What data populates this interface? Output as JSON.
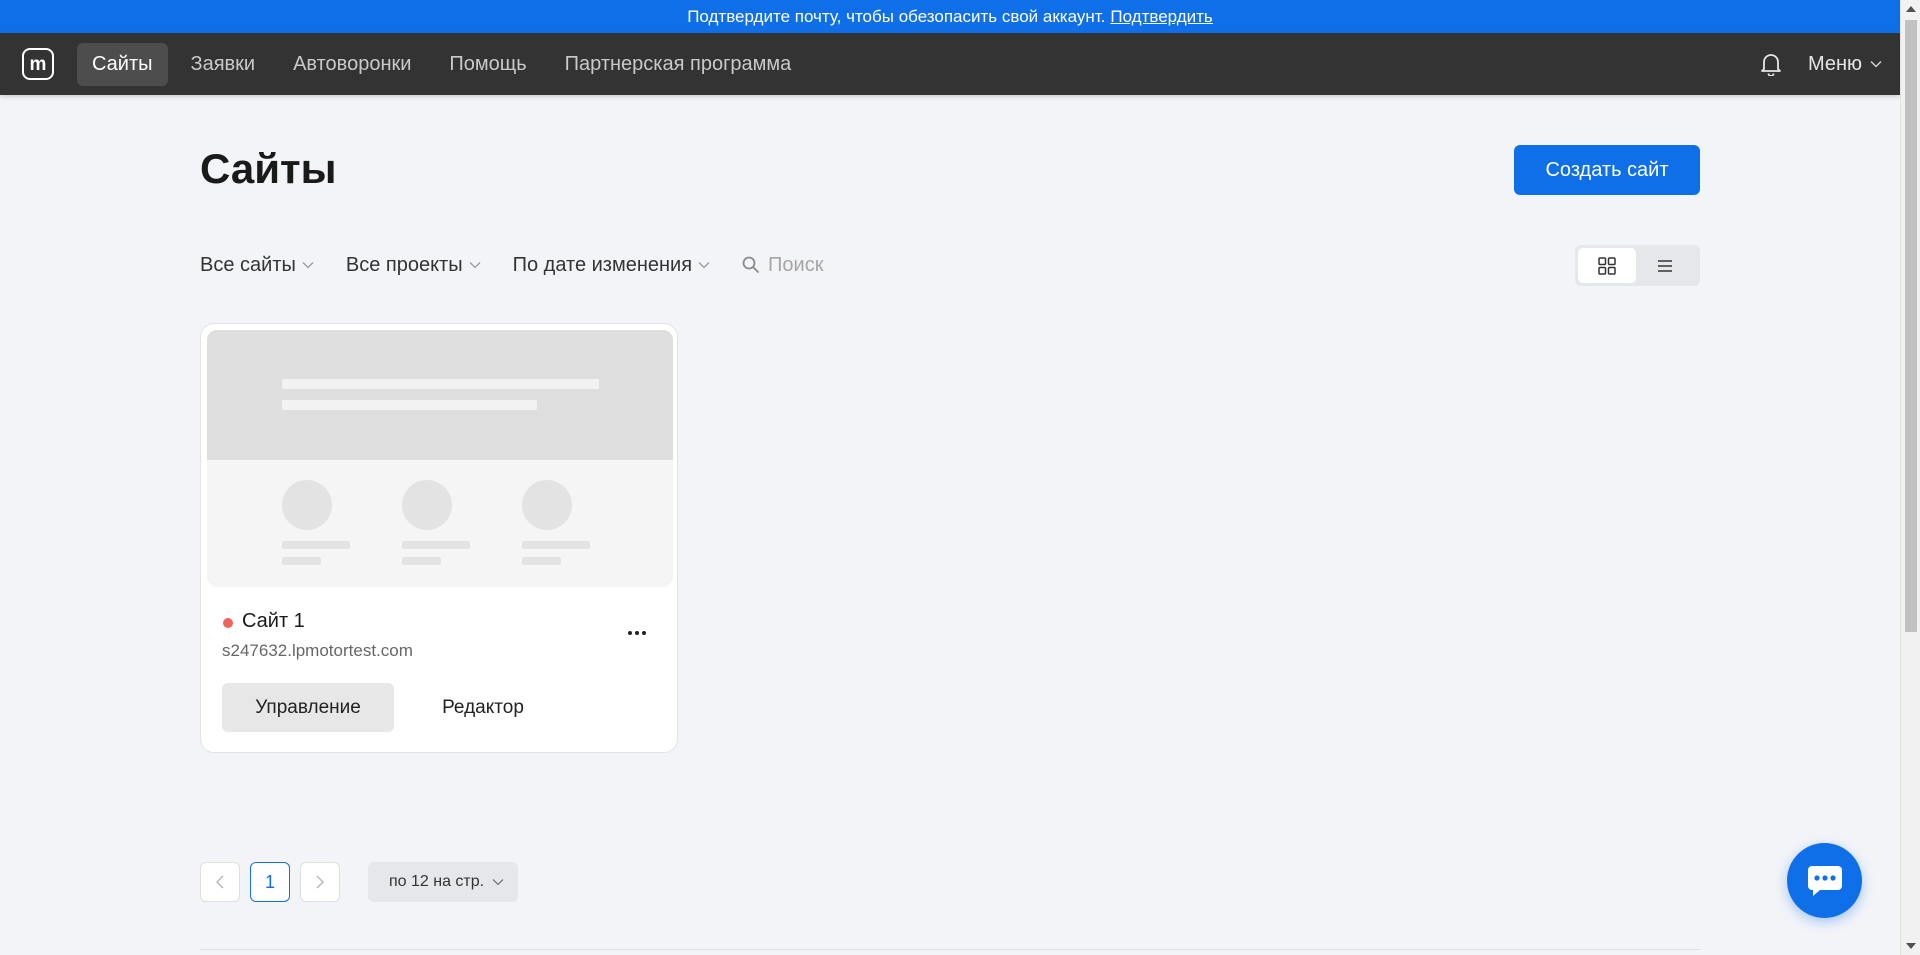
{
  "banner": {
    "text": "Подтвердите почту, чтобы обезопасить свой аккаунт.",
    "link": "Подтвердить"
  },
  "nav": {
    "logo": "m",
    "items": [
      {
        "label": "Сайты",
        "active": true
      },
      {
        "label": "Заявки",
        "active": false
      },
      {
        "label": "Автоворонки",
        "active": false
      },
      {
        "label": "Помощь",
        "active": false
      },
      {
        "label": "Партнерская программа",
        "active": false
      }
    ],
    "menu_label": "Меню"
  },
  "page": {
    "title": "Сайты",
    "create_button": "Создать сайт"
  },
  "filters": {
    "sites": "Все сайты",
    "projects": "Все проекты",
    "sort": "По дате изменения",
    "search_placeholder": "Поиск"
  },
  "view": {
    "mode": "grid"
  },
  "sites": [
    {
      "name": "Сайт 1",
      "domain": "s247632.lpmotortest.com",
      "status_color": "#f0625a",
      "manage_label": "Управление",
      "editor_label": "Редактор"
    }
  ],
  "pagination": {
    "current_page": "1",
    "per_page": "по 12 на стр."
  },
  "colors": {
    "accent": "#0f6fe8",
    "topbar": "#333333",
    "background": "#f3f4f8"
  }
}
